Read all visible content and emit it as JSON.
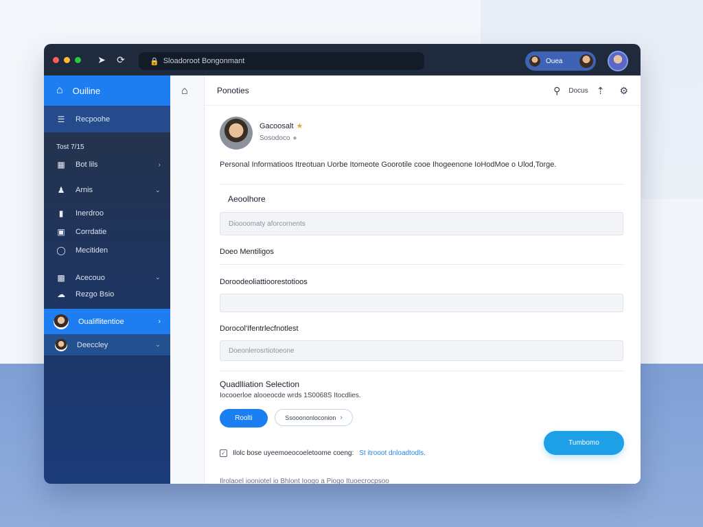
{
  "window": {
    "url": "Sloadoroot Bongonmant",
    "account_name": "Ouea",
    "traffic_lights": [
      "#ff5f57",
      "#febc2e",
      "#28c840"
    ]
  },
  "sidebar": {
    "app_name": "Ouiline",
    "items": [
      {
        "label": "Recpoohe",
        "icon": "menu-icon"
      },
      {
        "label": "Tost 7/15",
        "heading": true
      },
      {
        "label": "Bot lils",
        "icon": "table-icon"
      },
      {
        "label": "Arnis",
        "icon": "users-icon"
      },
      {
        "label": "Inerdroo",
        "icon": "bar-icon"
      },
      {
        "label": "Corrdatie",
        "icon": "calendar-icon"
      },
      {
        "label": "Mecitiden",
        "icon": "circle-icon"
      },
      {
        "label": "Acecouo",
        "icon": "briefcase-icon"
      },
      {
        "label": "Rezgo Bsio",
        "icon": "cloud-icon"
      },
      {
        "label": "Oualiflitentioe",
        "icon": "avatar"
      },
      {
        "label": "Deeccley",
        "icon": "avatar"
      }
    ]
  },
  "header": {
    "title": "Ponoties",
    "search_label": "Docus"
  },
  "profile": {
    "name": "Gacoosalt",
    "subtitle": "Sosodoco",
    "description": "Personal Informatioos Itreotuan Uorbe Itomeote Goorotile cooe Ihogeenone IoHodMoe o Ulod,Torge."
  },
  "sections": {
    "s1_title": "Aeoolhore",
    "s1_field": "Dioooomaty aforcornents",
    "s2_title": "Doeo Mentiligos",
    "s3_title": "Doroodeoliattioorestotioos",
    "s3_field": "",
    "s4_title": "Dorocol'Ifentrlecfnotlest",
    "s4_field": "Doeonlerosrtiotoeone",
    "s5_title": "Quadlliation Selection",
    "s5_sub": "Iocooerloe alooeocde wrds 1S0068S Itocdlies."
  },
  "actions": {
    "primary": "Roolti",
    "secondary": "Ssooononloconion",
    "big": "Tumbomo",
    "check_text": "Ilolc bose uyeemoeocoeletoome coeng:",
    "check_link": "St itrooot dnloadtodls.",
    "cutoff": "Ilrolaoel iooniotel io Bhlont Ioogo a Piogo Ituoecrocpsoo"
  }
}
